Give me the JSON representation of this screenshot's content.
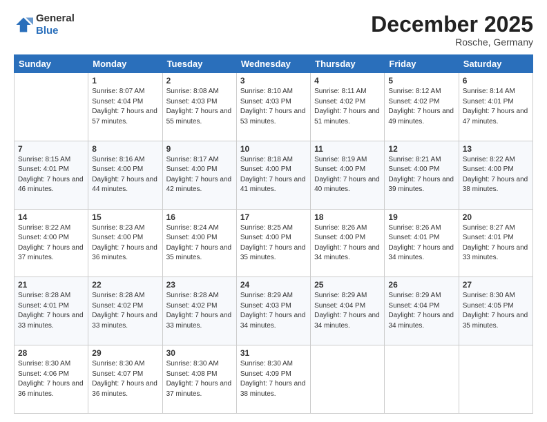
{
  "logo": {
    "line1": "General",
    "line2": "Blue"
  },
  "title": "December 2025",
  "subtitle": "Rosche, Germany",
  "days": [
    "Sunday",
    "Monday",
    "Tuesday",
    "Wednesday",
    "Thursday",
    "Friday",
    "Saturday"
  ],
  "weeks": [
    [
      {
        "num": "",
        "sunrise": "",
        "sunset": "",
        "daylight": ""
      },
      {
        "num": "1",
        "sunrise": "Sunrise: 8:07 AM",
        "sunset": "Sunset: 4:04 PM",
        "daylight": "Daylight: 7 hours and 57 minutes."
      },
      {
        "num": "2",
        "sunrise": "Sunrise: 8:08 AM",
        "sunset": "Sunset: 4:03 PM",
        "daylight": "Daylight: 7 hours and 55 minutes."
      },
      {
        "num": "3",
        "sunrise": "Sunrise: 8:10 AM",
        "sunset": "Sunset: 4:03 PM",
        "daylight": "Daylight: 7 hours and 53 minutes."
      },
      {
        "num": "4",
        "sunrise": "Sunrise: 8:11 AM",
        "sunset": "Sunset: 4:02 PM",
        "daylight": "Daylight: 7 hours and 51 minutes."
      },
      {
        "num": "5",
        "sunrise": "Sunrise: 8:12 AM",
        "sunset": "Sunset: 4:02 PM",
        "daylight": "Daylight: 7 hours and 49 minutes."
      },
      {
        "num": "6",
        "sunrise": "Sunrise: 8:14 AM",
        "sunset": "Sunset: 4:01 PM",
        "daylight": "Daylight: 7 hours and 47 minutes."
      }
    ],
    [
      {
        "num": "7",
        "sunrise": "Sunrise: 8:15 AM",
        "sunset": "Sunset: 4:01 PM",
        "daylight": "Daylight: 7 hours and 46 minutes."
      },
      {
        "num": "8",
        "sunrise": "Sunrise: 8:16 AM",
        "sunset": "Sunset: 4:00 PM",
        "daylight": "Daylight: 7 hours and 44 minutes."
      },
      {
        "num": "9",
        "sunrise": "Sunrise: 8:17 AM",
        "sunset": "Sunset: 4:00 PM",
        "daylight": "Daylight: 7 hours and 42 minutes."
      },
      {
        "num": "10",
        "sunrise": "Sunrise: 8:18 AM",
        "sunset": "Sunset: 4:00 PM",
        "daylight": "Daylight: 7 hours and 41 minutes."
      },
      {
        "num": "11",
        "sunrise": "Sunrise: 8:19 AM",
        "sunset": "Sunset: 4:00 PM",
        "daylight": "Daylight: 7 hours and 40 minutes."
      },
      {
        "num": "12",
        "sunrise": "Sunrise: 8:21 AM",
        "sunset": "Sunset: 4:00 PM",
        "daylight": "Daylight: 7 hours and 39 minutes."
      },
      {
        "num": "13",
        "sunrise": "Sunrise: 8:22 AM",
        "sunset": "Sunset: 4:00 PM",
        "daylight": "Daylight: 7 hours and 38 minutes."
      }
    ],
    [
      {
        "num": "14",
        "sunrise": "Sunrise: 8:22 AM",
        "sunset": "Sunset: 4:00 PM",
        "daylight": "Daylight: 7 hours and 37 minutes."
      },
      {
        "num": "15",
        "sunrise": "Sunrise: 8:23 AM",
        "sunset": "Sunset: 4:00 PM",
        "daylight": "Daylight: 7 hours and 36 minutes."
      },
      {
        "num": "16",
        "sunrise": "Sunrise: 8:24 AM",
        "sunset": "Sunset: 4:00 PM",
        "daylight": "Daylight: 7 hours and 35 minutes."
      },
      {
        "num": "17",
        "sunrise": "Sunrise: 8:25 AM",
        "sunset": "Sunset: 4:00 PM",
        "daylight": "Daylight: 7 hours and 35 minutes."
      },
      {
        "num": "18",
        "sunrise": "Sunrise: 8:26 AM",
        "sunset": "Sunset: 4:00 PM",
        "daylight": "Daylight: 7 hours and 34 minutes."
      },
      {
        "num": "19",
        "sunrise": "Sunrise: 8:26 AM",
        "sunset": "Sunset: 4:01 PM",
        "daylight": "Daylight: 7 hours and 34 minutes."
      },
      {
        "num": "20",
        "sunrise": "Sunrise: 8:27 AM",
        "sunset": "Sunset: 4:01 PM",
        "daylight": "Daylight: 7 hours and 33 minutes."
      }
    ],
    [
      {
        "num": "21",
        "sunrise": "Sunrise: 8:28 AM",
        "sunset": "Sunset: 4:01 PM",
        "daylight": "Daylight: 7 hours and 33 minutes."
      },
      {
        "num": "22",
        "sunrise": "Sunrise: 8:28 AM",
        "sunset": "Sunset: 4:02 PM",
        "daylight": "Daylight: 7 hours and 33 minutes."
      },
      {
        "num": "23",
        "sunrise": "Sunrise: 8:28 AM",
        "sunset": "Sunset: 4:02 PM",
        "daylight": "Daylight: 7 hours and 33 minutes."
      },
      {
        "num": "24",
        "sunrise": "Sunrise: 8:29 AM",
        "sunset": "Sunset: 4:03 PM",
        "daylight": "Daylight: 7 hours and 34 minutes."
      },
      {
        "num": "25",
        "sunrise": "Sunrise: 8:29 AM",
        "sunset": "Sunset: 4:04 PM",
        "daylight": "Daylight: 7 hours and 34 minutes."
      },
      {
        "num": "26",
        "sunrise": "Sunrise: 8:29 AM",
        "sunset": "Sunset: 4:04 PM",
        "daylight": "Daylight: 7 hours and 34 minutes."
      },
      {
        "num": "27",
        "sunrise": "Sunrise: 8:30 AM",
        "sunset": "Sunset: 4:05 PM",
        "daylight": "Daylight: 7 hours and 35 minutes."
      }
    ],
    [
      {
        "num": "28",
        "sunrise": "Sunrise: 8:30 AM",
        "sunset": "Sunset: 4:06 PM",
        "daylight": "Daylight: 7 hours and 36 minutes."
      },
      {
        "num": "29",
        "sunrise": "Sunrise: 8:30 AM",
        "sunset": "Sunset: 4:07 PM",
        "daylight": "Daylight: 7 hours and 36 minutes."
      },
      {
        "num": "30",
        "sunrise": "Sunrise: 8:30 AM",
        "sunset": "Sunset: 4:08 PM",
        "daylight": "Daylight: 7 hours and 37 minutes."
      },
      {
        "num": "31",
        "sunrise": "Sunrise: 8:30 AM",
        "sunset": "Sunset: 4:09 PM",
        "daylight": "Daylight: 7 hours and 38 minutes."
      },
      {
        "num": "",
        "sunrise": "",
        "sunset": "",
        "daylight": ""
      },
      {
        "num": "",
        "sunrise": "",
        "sunset": "",
        "daylight": ""
      },
      {
        "num": "",
        "sunrise": "",
        "sunset": "",
        "daylight": ""
      }
    ]
  ]
}
